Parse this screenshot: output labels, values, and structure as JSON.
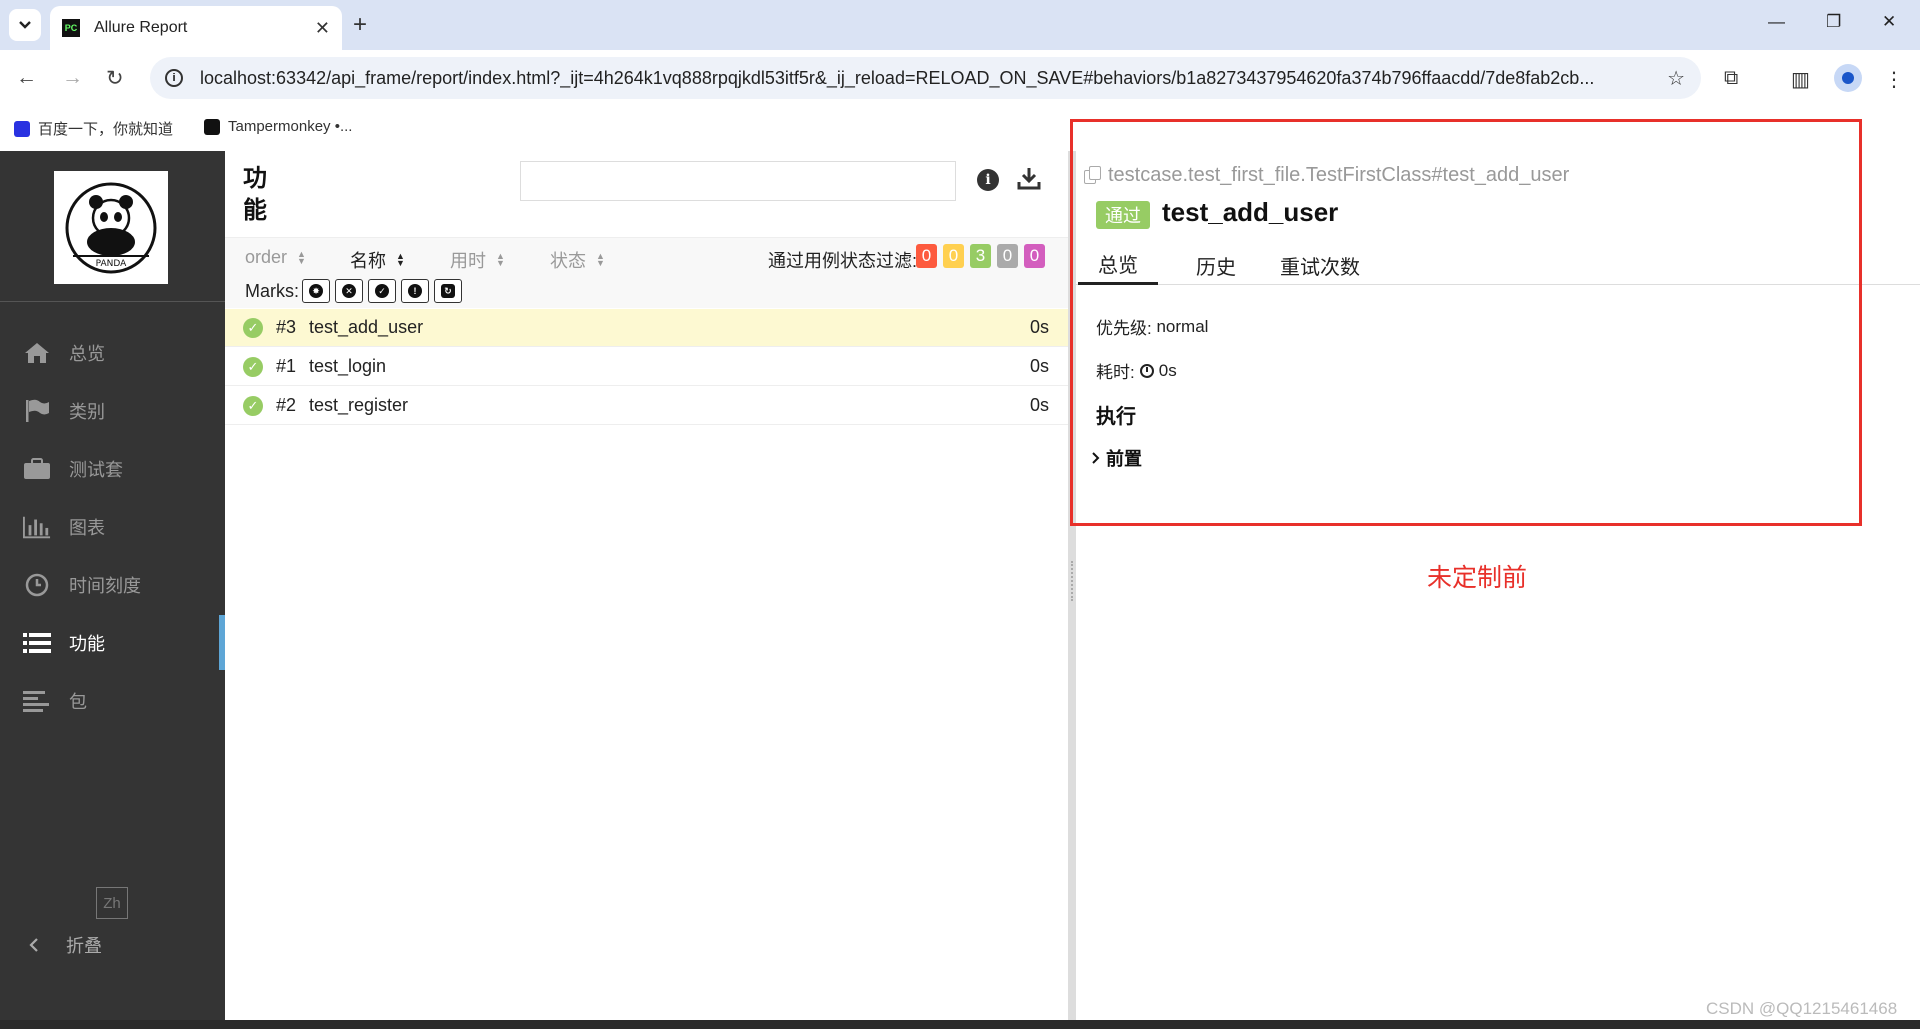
{
  "browser": {
    "tab_title": "Allure Report",
    "url": "localhost:63342/api_frame/report/index.html?_ijt=4h264k1vq888rpqjkdl53itf5r&_ij_reload=RELOAD_ON_SAVE#behaviors/b1a8273437954620fa374b796ffaacdd/7de8fab2cb...",
    "favicon_text": "PC",
    "new_tab": "+",
    "close_tab": "✕",
    "bookmarks": [
      "百度一下，你就知道",
      "Tampermonkey •..."
    ]
  },
  "sidebar": {
    "items": [
      {
        "label": "总览",
        "icon": "home-icon"
      },
      {
        "label": "类别",
        "icon": "flag-icon"
      },
      {
        "label": "测试套",
        "icon": "briefcase-icon"
      },
      {
        "label": "图表",
        "icon": "bar-chart-icon"
      },
      {
        "label": "时间刻度",
        "icon": "clock-icon"
      },
      {
        "label": "功能",
        "icon": "list-icon",
        "active": true
      },
      {
        "label": "包",
        "icon": "align-left-icon"
      }
    ],
    "lang": "Zh",
    "collapse": "折叠"
  },
  "tree": {
    "title": "功能",
    "search_placeholder": "",
    "sort_columns": [
      "order",
      "名称",
      "用时",
      "状态"
    ],
    "filter_label": "通过用例状态过滤:",
    "status_counts": [
      {
        "value": "0",
        "color": "#fd5a3e"
      },
      {
        "value": "0",
        "color": "#ffd050"
      },
      {
        "value": "3",
        "color": "#97cc64"
      },
      {
        "value": "0",
        "color": "#aaaaaa"
      },
      {
        "value": "0",
        "color": "#d35ebe"
      }
    ],
    "marks_label": "Marks:",
    "rows": [
      {
        "order": "#3",
        "name": "test_add_user",
        "duration": "0s",
        "selected": true
      },
      {
        "order": "#1",
        "name": "test_login",
        "duration": "0s"
      },
      {
        "order": "#2",
        "name": "test_register",
        "duration": "0s"
      }
    ]
  },
  "detail": {
    "fullname": "testcase.test_first_file.TestFirstClass#test_add_user",
    "status": "通过",
    "name": "test_add_user",
    "tabs": [
      "总览",
      "历史",
      "重试次数"
    ],
    "priority_label": "优先级:",
    "priority_value": "normal",
    "duration_label": "耗时:",
    "duration_value": "0s",
    "execution_heading": "执行",
    "setup_label": "前置"
  },
  "annotation": "未定制前",
  "watermark": "CSDN @QQ1215461468",
  "colors": {
    "accent": "#5ea6d6",
    "passed": "#97cc64",
    "annotation_red": "#e8302a"
  }
}
